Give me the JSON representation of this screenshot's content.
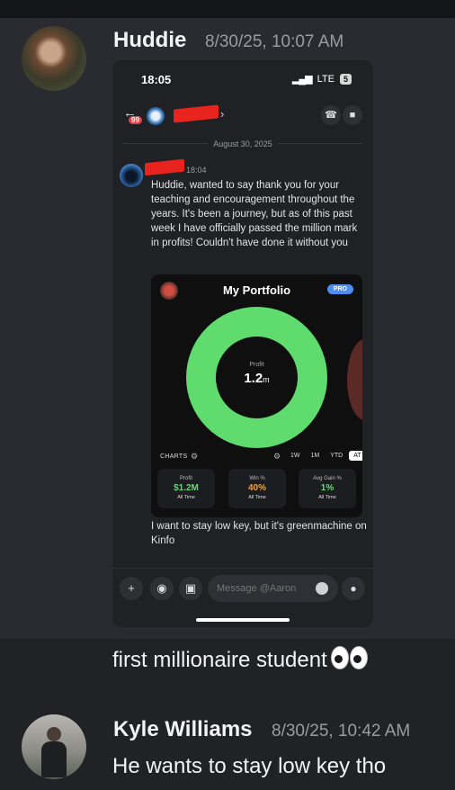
{
  "messages": [
    {
      "author": "Huddie",
      "timestamp": "8/30/25, 10:07 AM",
      "followup_text": "first millionaire student"
    },
    {
      "author": "Kyle Williams",
      "timestamp": "8/30/25, 10:42 AM",
      "text": "He wants to stay low key tho"
    }
  ],
  "screenshot": {
    "status": {
      "time": "18:05",
      "carrier": "LTE",
      "battery": "5"
    },
    "header": {
      "unread_badge": "99"
    },
    "date_divider": "August 30, 2025",
    "message": {
      "time": "18:04",
      "text": "Huddie, wanted to say thank you for your teaching and encouragement throughout the years. It's been a journey, but as of this past week I have officially passed the million mark in profits! Couldn't have done it without you",
      "text2": "I want to stay low key, but it's greenmachine on Kinfo"
    },
    "portfolio": {
      "title": "My Portfolio",
      "pro_label": "PRO",
      "donut_label": "Profit",
      "donut_value": "1.2",
      "donut_unit": "m",
      "donut_color": "#5fdc6d",
      "charts_label": "CHARTS",
      "ranges": [
        "1W",
        "1M",
        "YTD",
        "AT"
      ],
      "active_range": "AT",
      "stats": [
        {
          "label": "Profit",
          "value": "$1.2M",
          "sub": "All Time",
          "color": "#5fdc6d"
        },
        {
          "label": "Win %",
          "value": "40%",
          "sub": "All Time",
          "color": "#f0a23a"
        },
        {
          "label": "Avg Gain %",
          "value": "1%",
          "sub": "All Time",
          "color": "#5fdc6d"
        }
      ]
    },
    "composer": {
      "placeholder": "Message @Aaron"
    }
  }
}
